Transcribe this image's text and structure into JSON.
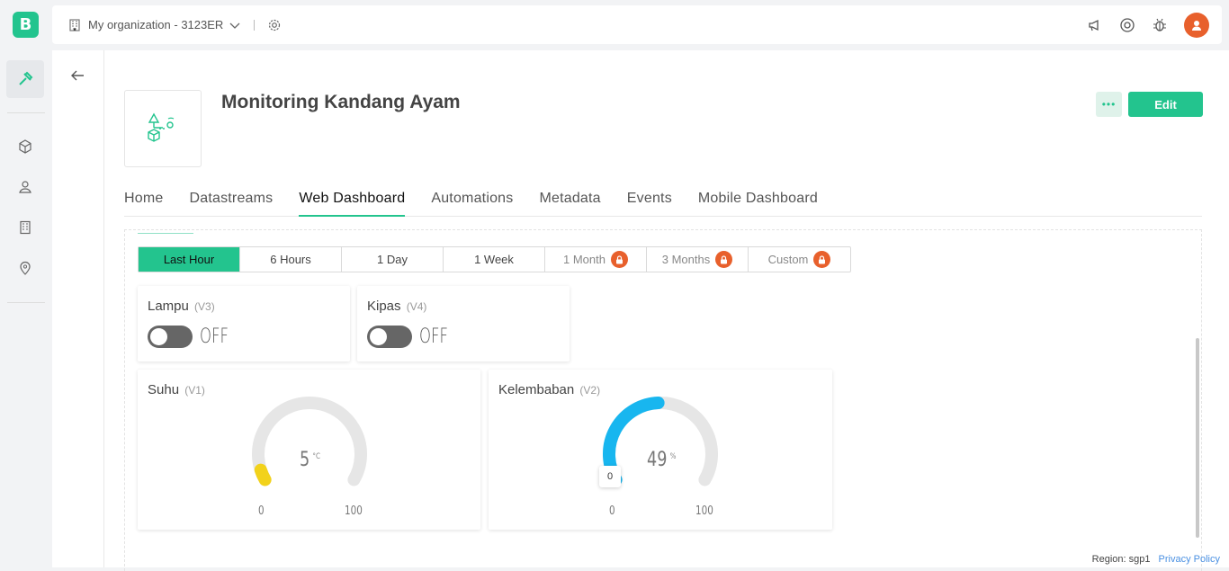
{
  "app": {
    "logo_letter": "B",
    "brand_color": "#23c48e"
  },
  "topbar": {
    "org_label": "My organization - 3123ER",
    "icons": [
      "building-icon",
      "chevron-down-icon",
      "gear-icon",
      "megaphone-icon",
      "help-icon",
      "bug-icon",
      "avatar"
    ]
  },
  "rail": {
    "items": [
      "wrench-icon",
      "cube-icon",
      "location-user-icon",
      "building-icon",
      "pin-icon"
    ]
  },
  "device": {
    "title": "Monitoring Kandang Ayam",
    "more_label": "•••",
    "edit_label": "Edit"
  },
  "tabs": [
    {
      "label": "Home"
    },
    {
      "label": "Datastreams"
    },
    {
      "label": "Web Dashboard",
      "active": true
    },
    {
      "label": "Automations"
    },
    {
      "label": "Metadata"
    },
    {
      "label": "Events"
    },
    {
      "label": "Mobile Dashboard"
    }
  ],
  "time_ranges": [
    {
      "label": "Last Hour",
      "active": true,
      "locked": false
    },
    {
      "label": "6 Hours",
      "locked": false
    },
    {
      "label": "1 Day",
      "locked": false
    },
    {
      "label": "1 Week",
      "locked": false
    },
    {
      "label": "1 Month",
      "locked": true
    },
    {
      "label": "3 Months",
      "locked": true
    },
    {
      "label": "Custom",
      "locked": true
    }
  ],
  "widgets": {
    "lampu": {
      "title": "Lampu",
      "pin": "(V3)",
      "state": "OFF"
    },
    "kipas": {
      "title": "Kipas",
      "pin": "(V4)",
      "state": "OFF"
    },
    "suhu": {
      "title": "Suhu",
      "pin": "(V1)",
      "value": "5",
      "unit": "°C",
      "min": "0",
      "max": "100",
      "level": 5,
      "color": "#f2d21b"
    },
    "kelembaban": {
      "title": "Kelembaban",
      "pin": "(V2)",
      "value": "49",
      "unit": "%",
      "min": "0",
      "max": "100",
      "level": 49,
      "color": "#18b6ef",
      "tooltip": "0"
    }
  },
  "footer": {
    "region": "Region: sgp1",
    "privacy": "Privacy Policy"
  }
}
